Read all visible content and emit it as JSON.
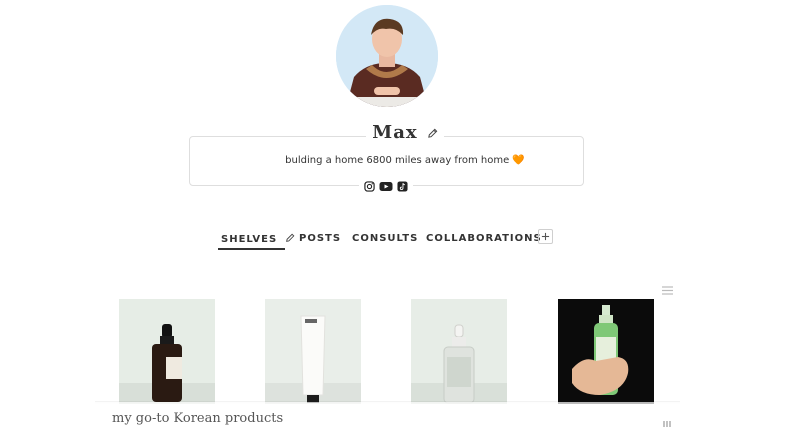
{
  "profile": {
    "name": "Max",
    "bio": "bulding a home 6800 miles away from home 🧡"
  },
  "social": [
    "instagram-icon",
    "youtube-icon",
    "tiktok-icon"
  ],
  "tabs": {
    "shelves": "SHELVES",
    "posts": "POSTS",
    "consults": "CONSULTS",
    "collaborations": "COLLABORATIONS"
  },
  "shelf": {
    "title": "my go-to Korean products",
    "products": [
      "serum-dropper-bottle",
      "white-tube-cream",
      "clear-serum-bottle",
      "green-spray-bottle"
    ]
  }
}
